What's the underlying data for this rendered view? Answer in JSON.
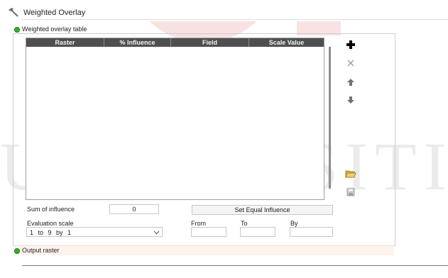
{
  "window": {
    "title": "Weighted Overlay"
  },
  "table_section": {
    "title": "Weighted overlay table"
  },
  "table": {
    "columns": [
      "Raster",
      "% Influence",
      "Field",
      "Scale Value"
    ],
    "rows": []
  },
  "side_buttons": [
    "add-icon",
    "remove-icon",
    "move-up-icon",
    "move-down-icon",
    "open-folder-icon",
    "save-icon"
  ],
  "sum": {
    "label": "Sum of influence",
    "value": "0"
  },
  "equal_button": {
    "label": "Set Equal Influence"
  },
  "evaluation": {
    "label": "Evaluation scale",
    "value": "1 to 9 by 1"
  },
  "range": {
    "from_label": "From",
    "to_label": "To",
    "by_label": "By",
    "from": "",
    "to": "",
    "by": ""
  },
  "output_section": {
    "title": "Output raster",
    "value": ""
  },
  "watermark": {
    "text": "UNIVERSITI"
  },
  "colors": {
    "header_bg": "#4f4f4f",
    "section_dot": "#2fb12f",
    "add_icon": "#000000"
  }
}
